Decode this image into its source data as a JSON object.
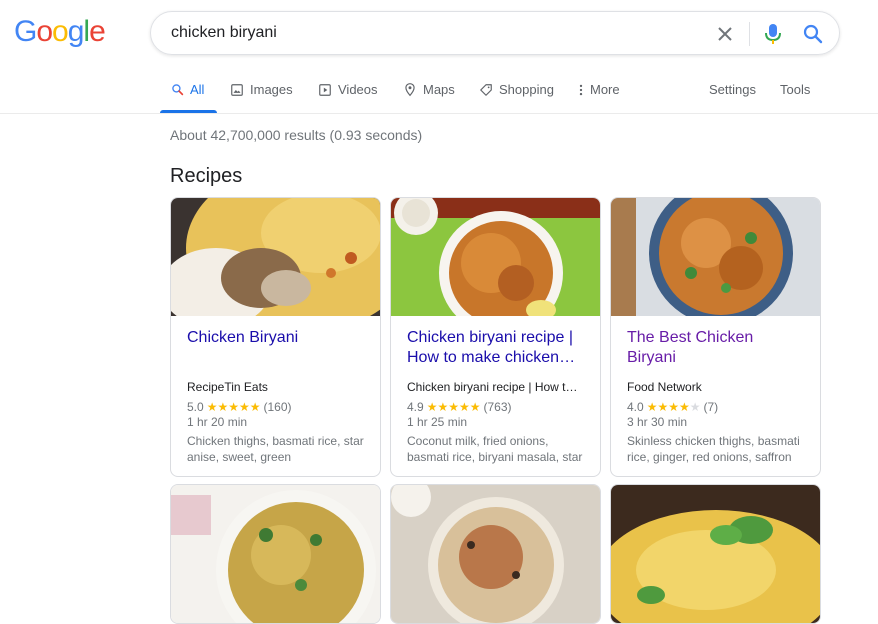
{
  "logo": {
    "letters": [
      "G",
      "o",
      "o",
      "g",
      "l",
      "e"
    ],
    "colors": [
      "#4285f4",
      "#ea4335",
      "#fbbc05",
      "#4285f4",
      "#34a853",
      "#ea4335"
    ]
  },
  "search": {
    "query": "chicken biryani"
  },
  "tabs": [
    {
      "label": "All",
      "icon": "search-icon"
    },
    {
      "label": "Images",
      "icon": "image-icon"
    },
    {
      "label": "Videos",
      "icon": "video-icon"
    },
    {
      "label": "Maps",
      "icon": "map-pin-icon"
    },
    {
      "label": "Shopping",
      "icon": "tag-icon"
    },
    {
      "label": "More",
      "icon": "more-vertical-icon"
    },
    {
      "label": "Settings"
    },
    {
      "label": "Tools"
    }
  ],
  "results_stats": "About 42,700,000 results (0.93 seconds)",
  "section_title": "Recipes",
  "recipes": [
    {
      "title": "Chicken Biryani",
      "source": "RecipeTin Eats",
      "rating": "5.0",
      "stars": 5,
      "reviews": "(160)",
      "time": "1 hr 20 min",
      "ingredients": "Chicken thighs, basmati rice, star anise, sweet, green"
    },
    {
      "title": "Chicken biryani recipe | How to make chicken…",
      "source": "Chicken biryani recipe | How to…",
      "rating": "4.9",
      "stars": 5,
      "reviews": "(763)",
      "time": "1 hr 25 min",
      "ingredients": "Coconut milk, fried onions, basmati rice, biryani masala, star"
    },
    {
      "title": "The Best Chicken Biryani",
      "source": "Food Network",
      "rating": "4.0",
      "stars": 4,
      "reviews": "(7)",
      "time": "3 hr 30 min",
      "ingredients": "Skinless chicken thighs, basmati rice, ginger, red onions, saffron"
    }
  ],
  "colors": {
    "accent": "#1a73e8",
    "link": "#1a0dab",
    "visited": "#681da8",
    "star": "#fbbc04"
  }
}
